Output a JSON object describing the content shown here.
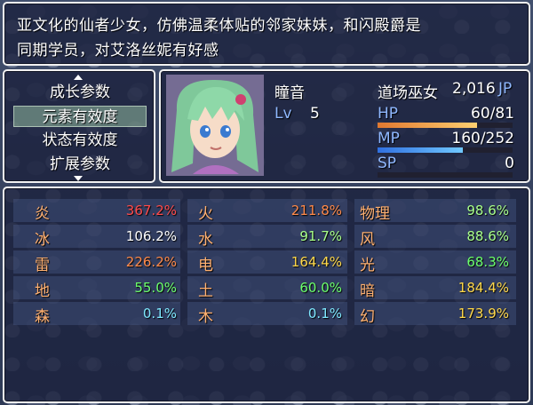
{
  "help": {
    "line1": "亚文化的仙者少女，仿佛温柔体贴的邻家妹妹，和闪殿爵是",
    "line2": "同期学员，对艾洛丝妮有好感"
  },
  "menu": {
    "items": [
      {
        "label": "成长参数",
        "selected": false
      },
      {
        "label": "元素有效度",
        "selected": true
      },
      {
        "label": "状态有效度",
        "selected": false
      },
      {
        "label": "扩展参数",
        "selected": false
      }
    ]
  },
  "actor": {
    "name": "瞳音",
    "class": "道场巫女",
    "exp": "2,016",
    "exp_unit": "JP",
    "lv_label": "Lv",
    "level": "5",
    "hp_label": "HP",
    "hp": "60/81",
    "hp_rate": 0.74,
    "mp_label": "MP",
    "mp": "160/252",
    "mp_rate": 0.63,
    "sp_label": "SP",
    "sp": "0",
    "sp_rate": 0.0
  },
  "elements": {
    "col1": [
      {
        "name": "炎",
        "value": "367.2%",
        "color": "#ff4a4a"
      },
      {
        "name": "冰",
        "value": "106.2%",
        "color": "#ffffff"
      },
      {
        "name": "雷",
        "value": "226.2%",
        "color": "#ff8a4a"
      },
      {
        "name": "地",
        "value": "55.0%",
        "color": "#6cff6c"
      },
      {
        "name": "森",
        "value": "0.1%",
        "color": "#7fe8ff"
      }
    ],
    "col2": [
      {
        "name": "火",
        "value": "211.8%",
        "color": "#ff8a4a"
      },
      {
        "name": "水",
        "value": "91.7%",
        "color": "#a8ff8a"
      },
      {
        "name": "电",
        "value": "164.4%",
        "color": "#ffd84a"
      },
      {
        "name": "土",
        "value": "60.0%",
        "color": "#6cff6c"
      },
      {
        "name": "木",
        "value": "0.1%",
        "color": "#7fe8ff"
      }
    ],
    "col3": [
      {
        "name": "物理",
        "value": "98.6%",
        "color": "#a8ff8a"
      },
      {
        "name": "风",
        "value": "88.6%",
        "color": "#a8ff8a"
      },
      {
        "name": "光",
        "value": "68.3%",
        "color": "#6cff6c"
      },
      {
        "name": "暗",
        "value": "184.4%",
        "color": "#ffd84a"
      },
      {
        "name": "幻",
        "value": "173.9%",
        "color": "#ffd84a"
      }
    ]
  },
  "colors": {
    "hp_gauge": "#f0a040",
    "mp_gauge": "#4aa8ff",
    "sp_gauge": "#ffffff",
    "label_orange": "#ffb070",
    "label_blue": "#8fb8ff"
  }
}
